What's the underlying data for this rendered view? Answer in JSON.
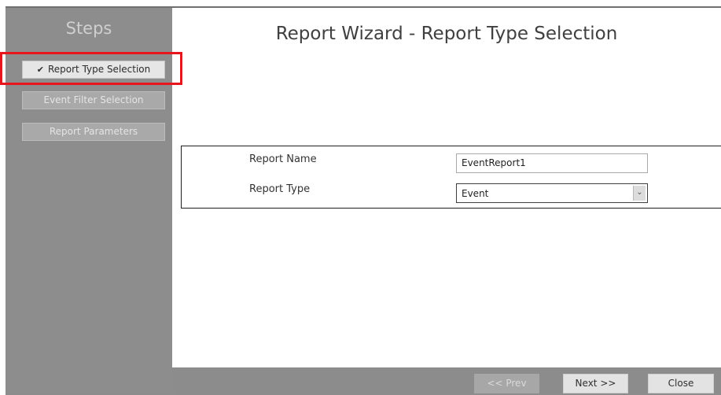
{
  "sidebar": {
    "title": "Steps",
    "items": [
      {
        "label": "Report Type Selection",
        "active": true,
        "icon": "check-icon",
        "check": "✔"
      },
      {
        "label": "Event Filter Selection",
        "active": false
      },
      {
        "label": "Report Parameters",
        "active": false
      }
    ]
  },
  "main": {
    "title": "Report Wizard - Report Type Selection",
    "form": {
      "report_name_label": "Report Name",
      "report_name_value": "EventReport1",
      "report_type_label": "Report Type",
      "report_type_value": "Event",
      "dropdown_arrow": "⌄"
    }
  },
  "footer": {
    "prev_label": "<< Prev",
    "next_label": "Next >>",
    "close_label": "Close"
  },
  "colors": {
    "highlight": "#e8161c",
    "panel_gray": "#8d8d8d",
    "active_step_bg": "#e6e6e6"
  }
}
